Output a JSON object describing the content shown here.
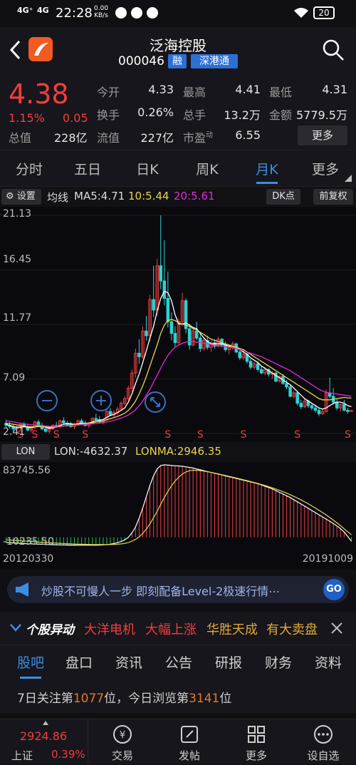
{
  "statusbar": {
    "signal1": "4G⁺",
    "signal2": "4G",
    "time": "22:28",
    "speed_value": "0.00",
    "speed_unit": "KB/s",
    "battery": "20"
  },
  "header": {
    "title": "泛海控股",
    "code": "000046",
    "badge1": "融",
    "badge2": "深港通"
  },
  "quote": {
    "price": "4.38",
    "change_pct": "1.15%",
    "change_abs": "0.05",
    "cap_label": "总值",
    "cap_value": "228亿",
    "fields": [
      {
        "label": "今开",
        "value": "4.33",
        "color": "#e6e6e6"
      },
      {
        "label": "最高",
        "value": "4.41",
        "color": "#f23d3d"
      },
      {
        "label": "最低",
        "value": "4.31",
        "color": "#1fbf3f"
      },
      {
        "label": "换手",
        "value": "0.26%",
        "color": "#e6e6e6"
      },
      {
        "label": "总手",
        "value": "13.2万",
        "color": "#e6e6e6"
      },
      {
        "label": "金额",
        "value": "5779.5万",
        "color": "#e6e6e6"
      },
      {
        "label": "流值",
        "value": "227亿",
        "color": "#e6e6e6"
      },
      {
        "label": "市盈",
        "value": "6.55",
        "color": "#e6e6e6"
      }
    ],
    "pe_suffix": "动",
    "more_label": "更多"
  },
  "tabs": [
    "分时",
    "五日",
    "日K",
    "周K",
    "月K",
    "更多"
  ],
  "active_tab": "月K",
  "kbar": {
    "settings": "设置",
    "ma_label": "均线",
    "ma5": "MA5:4.71",
    "ma10": "10:5.44",
    "ma20": "20:5.61",
    "dk_label": "DK点",
    "adjust_label": "前复权"
  },
  "chart_data": {
    "type": "candlestick",
    "y_ticks": [
      "21.13",
      "16.45",
      "11.77",
      "7.09",
      "2.41"
    ],
    "ylim": [
      2.41,
      21.13
    ],
    "x_start": "20120330",
    "x_end": "20191009",
    "candles": [
      [
        3.3,
        3.6,
        2.9,
        3.1
      ],
      [
        3.1,
        3.4,
        2.8,
        3.0
      ],
      [
        3.0,
        3.2,
        2.6,
        2.8
      ],
      [
        2.8,
        3.1,
        2.5,
        2.9
      ],
      [
        2.9,
        3.3,
        2.7,
        3.2
      ],
      [
        3.2,
        3.4,
        2.9,
        3.0
      ],
      [
        3.0,
        3.2,
        2.6,
        2.7
      ],
      [
        2.7,
        3.0,
        2.5,
        2.9
      ],
      [
        2.9,
        3.5,
        2.8,
        3.4
      ],
      [
        3.4,
        3.6,
        3.0,
        3.1
      ],
      [
        3.1,
        3.3,
        2.7,
        2.8
      ],
      [
        2.8,
        3.0,
        2.5,
        2.6
      ],
      [
        2.6,
        2.9,
        2.41,
        2.8
      ],
      [
        2.8,
        3.2,
        2.7,
        3.1
      ],
      [
        3.1,
        3.4,
        2.9,
        3.0
      ],
      [
        3.0,
        3.6,
        2.9,
        3.5
      ],
      [
        3.5,
        3.8,
        3.2,
        3.3
      ],
      [
        3.3,
        3.5,
        3.0,
        3.2
      ],
      [
        3.2,
        3.4,
        2.9,
        3.0
      ],
      [
        3.0,
        3.3,
        2.8,
        3.2
      ],
      [
        3.2,
        3.6,
        3.1,
        3.5
      ],
      [
        3.5,
        3.7,
        3.2,
        3.3
      ],
      [
        3.3,
        3.5,
        3.0,
        3.1
      ],
      [
        3.1,
        3.4,
        2.9,
        3.3
      ],
      [
        3.3,
        3.8,
        3.2,
        3.7
      ],
      [
        3.7,
        4.1,
        3.5,
        3.6
      ],
      [
        3.6,
        3.9,
        3.3,
        3.4
      ],
      [
        3.4,
        3.7,
        3.2,
        3.6
      ],
      [
        3.6,
        4.5,
        3.5,
        4.3
      ],
      [
        4.3,
        4.6,
        3.9,
        4.0
      ],
      [
        4.0,
        4.4,
        3.8,
        4.2
      ],
      [
        4.2,
        4.7,
        4.0,
        4.5
      ],
      [
        4.5,
        5.2,
        4.4,
        5.0
      ],
      [
        5.0,
        5.6,
        4.8,
        5.4
      ],
      [
        5.4,
        6.5,
        5.2,
        6.3
      ],
      [
        6.3,
        7.9,
        6.0,
        7.6
      ],
      [
        7.6,
        9.7,
        7.2,
        9.3
      ],
      [
        9.3,
        10.5,
        8.4,
        9.0
      ],
      [
        9.0,
        11.6,
        8.8,
        11.2
      ],
      [
        11.2,
        12.5,
        10.4,
        10.8
      ],
      [
        10.8,
        14.3,
        10.3,
        13.9
      ],
      [
        13.9,
        16.8,
        12.4,
        13.0
      ],
      [
        13.0,
        17.4,
        12.5,
        16.8
      ],
      [
        16.8,
        21.13,
        14.8,
        15.5
      ],
      [
        15.5,
        19.0,
        13.4,
        14.0
      ],
      [
        14.0,
        16.3,
        11.5,
        12.0
      ],
      [
        12.0,
        12.8,
        10.4,
        11.0
      ],
      [
        11.0,
        11.6,
        9.8,
        10.2
      ],
      [
        10.2,
        12.3,
        10.0,
        12.0
      ],
      [
        12.0,
        14.5,
        11.6,
        13.8
      ],
      [
        13.8,
        14.0,
        11.0,
        11.4
      ],
      [
        11.4,
        11.8,
        9.6,
        10.0
      ],
      [
        10.0,
        11.4,
        9.9,
        11.2
      ],
      [
        11.2,
        12.0,
        10.4,
        10.6
      ],
      [
        10.6,
        11.0,
        9.4,
        9.7
      ],
      [
        9.7,
        10.6,
        9.5,
        10.4
      ],
      [
        10.4,
        10.8,
        9.6,
        9.8
      ],
      [
        9.8,
        10.4,
        9.4,
        10.2
      ],
      [
        10.2,
        10.5,
        9.7,
        9.9
      ],
      [
        9.9,
        10.7,
        9.8,
        10.5
      ],
      [
        10.5,
        10.6,
        9.8,
        10.0
      ],
      [
        10.0,
        10.3,
        9.4,
        9.6
      ],
      [
        9.6,
        10.0,
        9.2,
        9.8
      ],
      [
        9.8,
        10.3,
        9.6,
        10.1
      ],
      [
        10.1,
        10.2,
        9.3,
        9.4
      ],
      [
        9.4,
        9.6,
        8.7,
        8.9
      ],
      [
        8.9,
        9.4,
        8.7,
        9.2
      ],
      [
        9.2,
        9.4,
        8.4,
        8.6
      ],
      [
        8.6,
        8.8,
        7.9,
        8.1
      ],
      [
        8.1,
        8.6,
        7.9,
        8.4
      ],
      [
        8.4,
        8.6,
        7.7,
        7.9
      ],
      [
        7.9,
        8.2,
        7.5,
        7.6
      ],
      [
        7.6,
        8.1,
        7.4,
        7.9
      ],
      [
        7.9,
        8.0,
        7.3,
        7.5
      ],
      [
        7.5,
        7.8,
        7.1,
        7.6
      ],
      [
        7.6,
        7.7,
        6.8,
        6.9
      ],
      [
        6.9,
        7.4,
        6.8,
        7.3
      ],
      [
        7.3,
        7.5,
        6.6,
        6.7
      ],
      [
        6.7,
        7.0,
        6.2,
        6.4
      ],
      [
        6.4,
        6.6,
        5.5,
        5.6
      ],
      [
        5.6,
        6.1,
        5.4,
        5.9
      ],
      [
        5.9,
        6.0,
        4.8,
        5.0
      ],
      [
        5.0,
        5.3,
        4.5,
        4.7
      ],
      [
        4.7,
        5.4,
        4.6,
        5.2
      ],
      [
        5.2,
        5.3,
        4.6,
        4.8
      ],
      [
        4.8,
        5.0,
        4.4,
        4.6
      ],
      [
        4.6,
        4.9,
        4.2,
        4.4
      ],
      [
        4.4,
        4.6,
        3.9,
        4.1
      ],
      [
        4.1,
        4.5,
        4.0,
        4.3
      ],
      [
        4.3,
        6.2,
        4.2,
        5.9
      ],
      [
        5.9,
        7.2,
        5.4,
        5.6
      ],
      [
        5.6,
        6.3,
        4.9,
        5.1
      ],
      [
        5.1,
        5.4,
        4.4,
        4.6
      ],
      [
        4.6,
        5.0,
        4.3,
        4.9
      ],
      [
        4.9,
        5.3,
        4.3,
        4.4
      ],
      [
        4.4,
        4.6,
        4.1,
        4.3
      ],
      [
        4.3,
        4.41,
        4.31,
        4.38
      ]
    ],
    "ma5": [
      3.2,
      3.1,
      3.0,
      2.95,
      2.95,
      3.0,
      2.95,
      2.9,
      3.0,
      3.05,
      3.0,
      2.95,
      2.85,
      2.9,
      3.0,
      3.1,
      3.2,
      3.25,
      3.25,
      3.2,
      3.25,
      3.3,
      3.3,
      3.3,
      3.4,
      3.5,
      3.55,
      3.6,
      3.8,
      3.95,
      4.05,
      4.2,
      4.4,
      4.6,
      5.1,
      5.8,
      6.7,
      7.5,
      8.5,
      9.5,
      10.6,
      11.6,
      12.9,
      14.0,
      14.6,
      14.5,
      13.8,
      12.6,
      11.8,
      11.8,
      11.9,
      11.7,
      11.5,
      11.4,
      11.0,
      10.6,
      10.3,
      10.1,
      10.1,
      10.1,
      10.1,
      10.0,
      9.9,
      9.9,
      9.8,
      9.6,
      9.4,
      9.2,
      8.9,
      8.7,
      8.5,
      8.2,
      8.0,
      7.8,
      7.6,
      7.4,
      7.2,
      7.0,
      6.8,
      6.6,
      6.3,
      6.0,
      5.7,
      5.4,
      5.2,
      5.0,
      4.8,
      4.6,
      4.5,
      4.6,
      4.8,
      5.0,
      5.1,
      5.1,
      5.0,
      4.8,
      4.71
    ],
    "ma10": [
      3.3,
      3.25,
      3.2,
      3.15,
      3.1,
      3.05,
      3.0,
      3.0,
      3.0,
      3.0,
      3.0,
      2.98,
      2.95,
      2.95,
      2.97,
      3.0,
      3.05,
      3.1,
      3.15,
      3.2,
      3.22,
      3.25,
      3.28,
      3.3,
      3.32,
      3.38,
      3.42,
      3.48,
      3.58,
      3.68,
      3.78,
      3.88,
      4.0,
      4.15,
      4.4,
      4.75,
      5.2,
      5.8,
      6.5,
      7.3,
      8.2,
      9.1,
      10.0,
      11.0,
      11.7,
      12.1,
      12.2,
      12.1,
      11.9,
      11.8,
      11.7,
      11.6,
      11.4,
      11.3,
      11.1,
      10.9,
      10.7,
      10.5,
      10.4,
      10.3,
      10.2,
      10.1,
      10.0,
      9.9,
      9.8,
      9.7,
      9.6,
      9.4,
      9.2,
      9.0,
      8.8,
      8.6,
      8.4,
      8.2,
      8.0,
      7.8,
      7.6,
      7.4,
      7.2,
      7.0,
      6.8,
      6.6,
      6.4,
      6.2,
      6.0,
      5.8,
      5.6,
      5.4,
      5.3,
      5.3,
      5.3,
      5.35,
      5.4,
      5.45,
      5.5,
      5.47,
      5.44
    ],
    "ma20": [
      3.5,
      3.45,
      3.4,
      3.35,
      3.3,
      3.25,
      3.2,
      3.17,
      3.14,
      3.11,
      3.08,
      3.05,
      3.03,
      3.02,
      3.02,
      3.03,
      3.05,
      3.07,
      3.1,
      3.12,
      3.14,
      3.16,
      3.18,
      3.2,
      3.23,
      3.26,
      3.3,
      3.34,
      3.4,
      3.47,
      3.55,
      3.64,
      3.74,
      3.86,
      4.0,
      4.2,
      4.45,
      4.8,
      5.2,
      5.7,
      6.2,
      6.8,
      7.4,
      8.0,
      8.6,
      9.1,
      9.5,
      9.8,
      10.0,
      10.15,
      10.25,
      10.3,
      10.3,
      10.25,
      10.2,
      10.15,
      10.1,
      10.05,
      10.0,
      9.95,
      9.9,
      9.85,
      9.8,
      9.75,
      9.7,
      9.6,
      9.5,
      9.4,
      9.3,
      9.2,
      9.1,
      9.0,
      8.85,
      8.7,
      8.55,
      8.4,
      8.25,
      8.1,
      7.95,
      7.8,
      7.6,
      7.4,
      7.2,
      7.0,
      6.8,
      6.6,
      6.4,
      6.2,
      6.05,
      5.95,
      5.9,
      5.85,
      5.8,
      5.75,
      5.7,
      5.65,
      5.61
    ],
    "s_markers": [
      4,
      8,
      14,
      22,
      45,
      54,
      66,
      81,
      95
    ],
    "indicator": {
      "name": "LON",
      "lon": "LON:-4632.37",
      "lonma": "LONMA:2946.35",
      "ylim": [
        -10235.5,
        83745.56
      ],
      "y_ticks": [
        "83745.56",
        "-10235.50"
      ],
      "lon_values": [
        -6000,
        -6200,
        -6500,
        -6700,
        -7000,
        -7200,
        -7500,
        -7600,
        -7800,
        -8000,
        -8100,
        -8300,
        -8400,
        -8600,
        -8700,
        -8800,
        -8900,
        -9000,
        -9050,
        -9100,
        -9150,
        -9200,
        -9200,
        -9200,
        -9150,
        -9100,
        -9000,
        -8800,
        -8500,
        -8000,
        -7300,
        -6300,
        -5000,
        -3000,
        0,
        5000,
        12000,
        22000,
        34000,
        47000,
        60000,
        71000,
        79000,
        83000,
        83745,
        83500,
        83000,
        82700,
        82400,
        82000,
        81500,
        80800,
        80000,
        79000,
        78000,
        77000,
        76000,
        75000,
        74000,
        73000,
        72000,
        71000,
        70000,
        69000,
        68000,
        67000,
        66000,
        65000,
        64000,
        63000,
        62000,
        60500,
        59000,
        57500,
        56000,
        54000,
        52000,
        50000,
        48000,
        46000,
        43500,
        41000,
        38500,
        36000,
        33500,
        31000,
        28500,
        26000,
        23500,
        21000,
        18500,
        16000,
        13000,
        10000,
        6000,
        1000,
        -4632.37
      ],
      "lonma_values": [
        -3000,
        -3200,
        -3500,
        -3800,
        -4000,
        -4300,
        -4600,
        -4900,
        -5200,
        -5500,
        -5800,
        -6100,
        -6400,
        -6600,
        -6800,
        -7000,
        -7200,
        -7400,
        -7600,
        -7800,
        -8000,
        -8100,
        -8200,
        -8300,
        -8400,
        -8450,
        -8500,
        -8500,
        -8450,
        -8400,
        -8300,
        -8100,
        -7700,
        -7000,
        -6000,
        -4500,
        -2500,
        500,
        4500,
        9500,
        15500,
        22500,
        30000,
        38000,
        46000,
        53000,
        59500,
        65000,
        69500,
        73000,
        75500,
        77000,
        77500,
        77500,
        77000,
        76500,
        75800,
        75000,
        74200,
        73300,
        72400,
        71500,
        70500,
        69500,
        68500,
        67500,
        66500,
        65500,
        64400,
        63300,
        62200,
        61000,
        59800,
        58500,
        57200,
        55800,
        54300,
        52700,
        51000,
        49200,
        47300,
        45300,
        43200,
        41000,
        38700,
        36300,
        33800,
        31200,
        28500,
        25700,
        22800,
        19800,
        16600,
        13300,
        9800,
        6300,
        2946.35
      ]
    }
  },
  "ad": {
    "text": "炒股不可慢人一步 即刻配备Level-2极速行情⋯",
    "go": "GO"
  },
  "news": {
    "brand": "个股异动",
    "item1_a": "大洋电机",
    "item1_b": "大幅上涨",
    "item2_a": "华胜天成",
    "item2_b": "有大卖盘"
  },
  "subtabs": [
    "股吧",
    "盘口",
    "资讯",
    "公告",
    "研报",
    "财务",
    "资料"
  ],
  "rank": {
    "prefix": "7日关注第",
    "rank1": "1077",
    "mid": "位，今日浏览第",
    "rank2": "3141",
    "suffix": "位"
  },
  "bottomnav": {
    "index_value": "2924.86",
    "index_name": "上证",
    "index_pct": "0.39%",
    "items": [
      "交易",
      "发帖",
      "更多",
      "设自选"
    ]
  }
}
